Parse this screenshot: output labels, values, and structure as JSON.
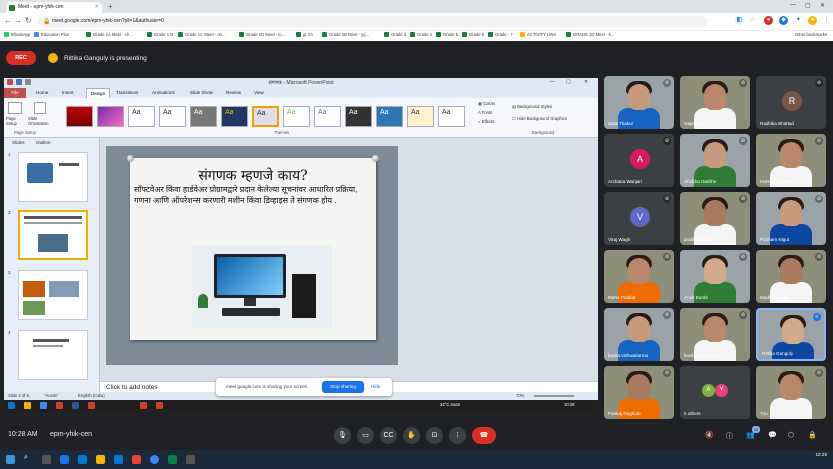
{
  "browser": {
    "tab_title": "Meet - epm-yhik-cen",
    "tab_close": "×",
    "new_tab": "+",
    "url": "meet.google.com/epm-yhik-cen?pli=1&authuser=0",
    "bookmarks": [
      "WhatsApp",
      "Education Plus",
      "Grade 1A Meet - ch...",
      "Grade 1 B",
      "Grade 1C Meet - on...",
      "Grade 1D Meet - lo...",
      "gr 2A",
      "Grade 2B Meet - yg...",
      "Grade 3",
      "Grade 4",
      "Grade 5",
      "Grade 6",
      "Grade - 7",
      "ACTIVITY LINK",
      "GRADE 1D Meet - k..."
    ],
    "other_bookmarks": "Other bookmarks"
  },
  "meet": {
    "rec_label": "REC",
    "presenting_text": "Rittika Ganguly is presenting",
    "time": "10:28 AM",
    "meeting_code": "epm-yhik-cen",
    "people_badge": "28",
    "share_notice": {
      "text": "meet.google.com is sharing your screen.",
      "stop": "Stop sharing",
      "hide": "Hide"
    }
  },
  "ppt": {
    "window_title": "संगणक - Microsoft PowerPoint",
    "tabs": [
      "File",
      "Home",
      "Insert",
      "Design",
      "Transitions",
      "Animations",
      "Slide Show",
      "Review",
      "View"
    ],
    "page_setup": [
      "Page Setup",
      "Slide Orientation"
    ],
    "group_labels": [
      "Page Setup",
      "Themes",
      "Background"
    ],
    "theme_sample": "Aa",
    "theme_menu": [
      "Colors",
      "Fonts",
      "Effects"
    ],
    "background_menu": [
      "Background Styles",
      "Hide Background Graphics"
    ],
    "panel_tabs": [
      "Slides",
      "Outline"
    ],
    "thumbnails": [
      "1",
      "2",
      "3",
      "4"
    ],
    "slide": {
      "title": "संगणक म्हणजे काय?",
      "body": "सॉफ्टवेअर किंवा हार्डवेअर प्रोग्रामद्वारे प्रदान केलेल्या सूचनांवर आधारित प्रक्रिया, गणना आणि ऑपरेशन्स करणारी मशीन किंवा डिव्हाइस ते संगणक होय ."
    },
    "notes_placeholder": "Click to add notes",
    "status": {
      "slide_of": "Slide 2 of 5",
      "theme": "\"Austin\"",
      "language": "English (India)",
      "zoom": "70%"
    },
    "win_tray": {
      "weather": "34°C Haze",
      "time": "10:28"
    }
  },
  "participants": [
    {
      "name": "Sara Thakur",
      "type": "video",
      "muted": true
    },
    {
      "name": "Gajendra",
      "type": "video",
      "muted": true
    },
    {
      "name": "Radhika Bhattad",
      "type": "avatar",
      "initial": "R",
      "color": "#795548",
      "muted": true
    },
    {
      "name": "Archana Wanjari",
      "type": "avatar",
      "initial": "A",
      "color": "#d81b60",
      "muted": true
    },
    {
      "name": "Shubha Darbhe",
      "type": "video",
      "muted": true
    },
    {
      "name": "Harshika Upase",
      "type": "video",
      "muted": true
    },
    {
      "name": "Viraj Wagh",
      "type": "avatar",
      "initial": "V",
      "color": "#5c6bc0",
      "muted": true
    },
    {
      "name": "prabhat Kumar",
      "type": "video",
      "muted": true
    },
    {
      "name": "Poonam Nigut",
      "type": "video",
      "muted": true
    },
    {
      "name": "Mahir Poddar",
      "type": "video",
      "muted": true
    },
    {
      "name": "Ansh Burde",
      "type": "video",
      "muted": true
    },
    {
      "name": "Madhavi Sujit",
      "type": "video",
      "muted": true
    },
    {
      "name": "kavita vishwakarma",
      "type": "video",
      "muted": true
    },
    {
      "name": "kavita vishwakarma",
      "type": "video",
      "muted": true
    },
    {
      "name": "Rittika Ganguly",
      "type": "video",
      "muted": false
    },
    {
      "name": "Pankaj Raghute",
      "type": "video",
      "muted": true
    },
    {
      "name": "5 others",
      "type": "others",
      "muted": false
    },
    {
      "name": "You",
      "type": "video",
      "muted": true
    }
  ],
  "others_initials": [
    "A",
    "Y"
  ],
  "colors": {
    "rec": "#d93025",
    "end_call": "#d93025",
    "stop_sharing": "#1a73e8",
    "active_speaker": "#8ab4f8"
  }
}
